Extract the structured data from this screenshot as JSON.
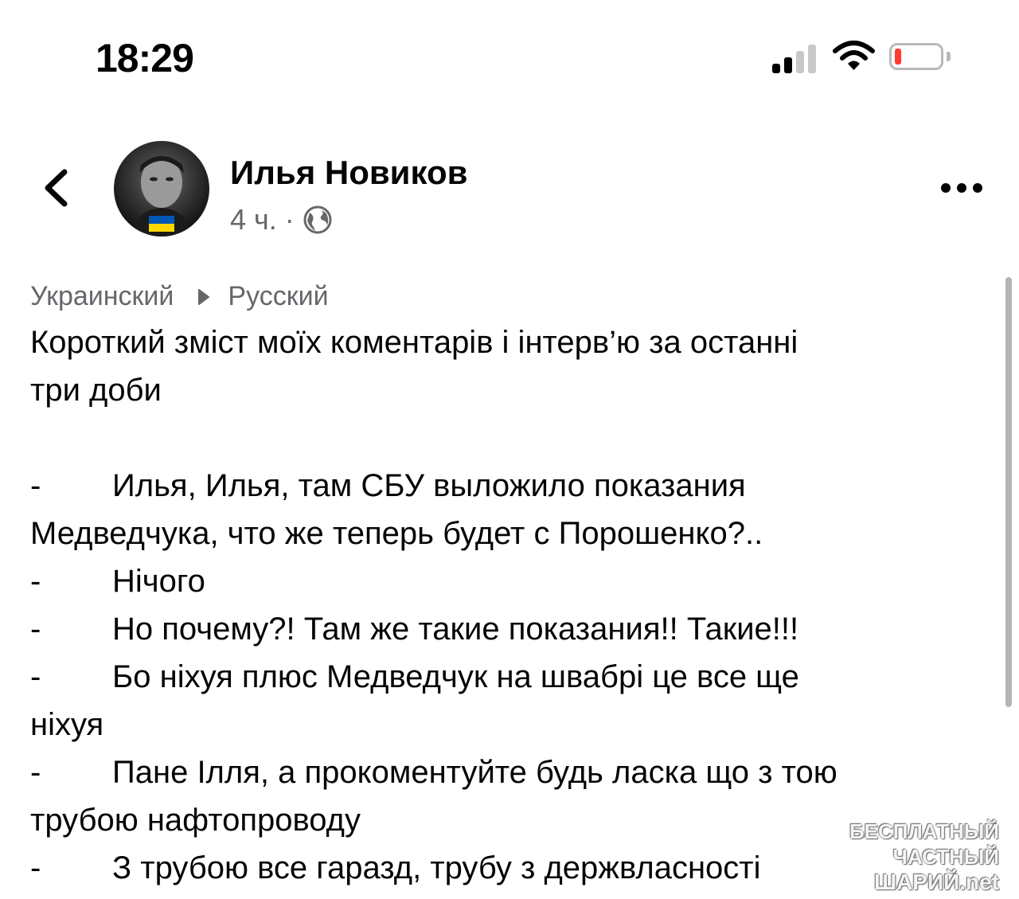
{
  "status_bar": {
    "time": "18:29"
  },
  "post": {
    "author": "Илья Новиков",
    "time_ago": "4 ч.",
    "separator": "·",
    "translation": {
      "from": "Украинский",
      "to": "Русский"
    },
    "title_line1": "Короткий зміст моїх коментарів і інтерв’ю за останні",
    "title_line2": "три доби",
    "dash": "-",
    "q1_line1": "Илья, Илья, там СБУ выложило показания",
    "q1_line2": "Медведчука, что же теперь будет с Порошенко?..",
    "a1": "Нічого",
    "q2": "Но почему?! Там же такие показания!! Такие!!!",
    "a2_line1": "Бо ніхуя плюс Медведчук на швабрі це все ще",
    "a2_line2": "ніхуя",
    "q3_line1": "Пане Ілля, а прокоментуйте будь ласка що з тою",
    "q3_line2": "трубою нафтопроводу",
    "a3_line1": "З трубою все гаразд, трубу з держвласності"
  },
  "watermark": {
    "line1": "БЕСПЛАТНЫЙ ЧАСТНЫЙ",
    "line2": "ШАРИЙ.net"
  },
  "icons": {
    "back": "chevron-left-icon",
    "more": "more-dots-icon",
    "globe": "globe-icon",
    "signal": "cellular-signal-icon",
    "wifi": "wifi-icon",
    "battery": "battery-icon"
  },
  "colors": {
    "text": "#050505",
    "secondary": "#65676b",
    "battery_low": "#ff3b30",
    "flag_blue": "#0057b7",
    "flag_yellow": "#ffd700"
  }
}
